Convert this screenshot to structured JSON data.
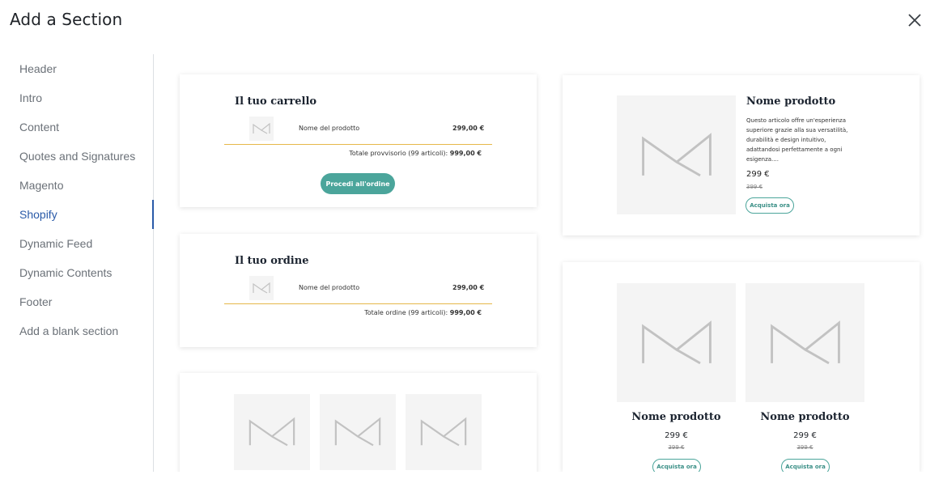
{
  "dialog": {
    "title": "Add a Section"
  },
  "sidebar": {
    "items": [
      {
        "label": "Header"
      },
      {
        "label": "Intro"
      },
      {
        "label": "Content"
      },
      {
        "label": "Quotes and Signatures"
      },
      {
        "label": "Magento"
      },
      {
        "label": "Shopify"
      },
      {
        "label": "Dynamic Feed"
      },
      {
        "label": "Dynamic Contents"
      },
      {
        "label": "Footer"
      },
      {
        "label": "Add a blank section"
      }
    ],
    "active": "Shopify"
  },
  "cart_card": {
    "title": "Il tuo carrello",
    "product_name": "Nome del prodotto",
    "price": "299,00 €",
    "subtotal_label": "Totale provvisorio (99 articoli):",
    "subtotal_value": "999,00 €",
    "button_label": "Procedi all'ordine"
  },
  "order_card": {
    "title": "Il tuo ordine",
    "product_name": "Nome del prodotto",
    "price": "299,00 €",
    "total_label": "Totale ordine (99 articoli):",
    "total_value": "999,00 €"
  },
  "product_card": {
    "title": "Nome prodotto",
    "description": "Questo articolo offre un'esperienza superiore grazie alla sua versatilità, durabilità e design intuitivo, adattandosi perfettamente a ogni esigenza....",
    "price": "299 €",
    "old_price": "399 €",
    "button_label": "Acquista ora"
  },
  "two_products_card": {
    "products": [
      {
        "title": "Nome prodotto",
        "price": "299 €",
        "old_price": "399 €",
        "button_label": "Acquista ora"
      },
      {
        "title": "Nome prodotto",
        "price": "299 €",
        "old_price": "399 €",
        "button_label": "Acquista ora"
      }
    ]
  },
  "colors": {
    "accent": "#2a5aa8",
    "teal": "#4ba59b",
    "divider": "#e6b84a"
  },
  "icons": {
    "close": "close-icon",
    "placeholder": "image-placeholder-icon"
  }
}
